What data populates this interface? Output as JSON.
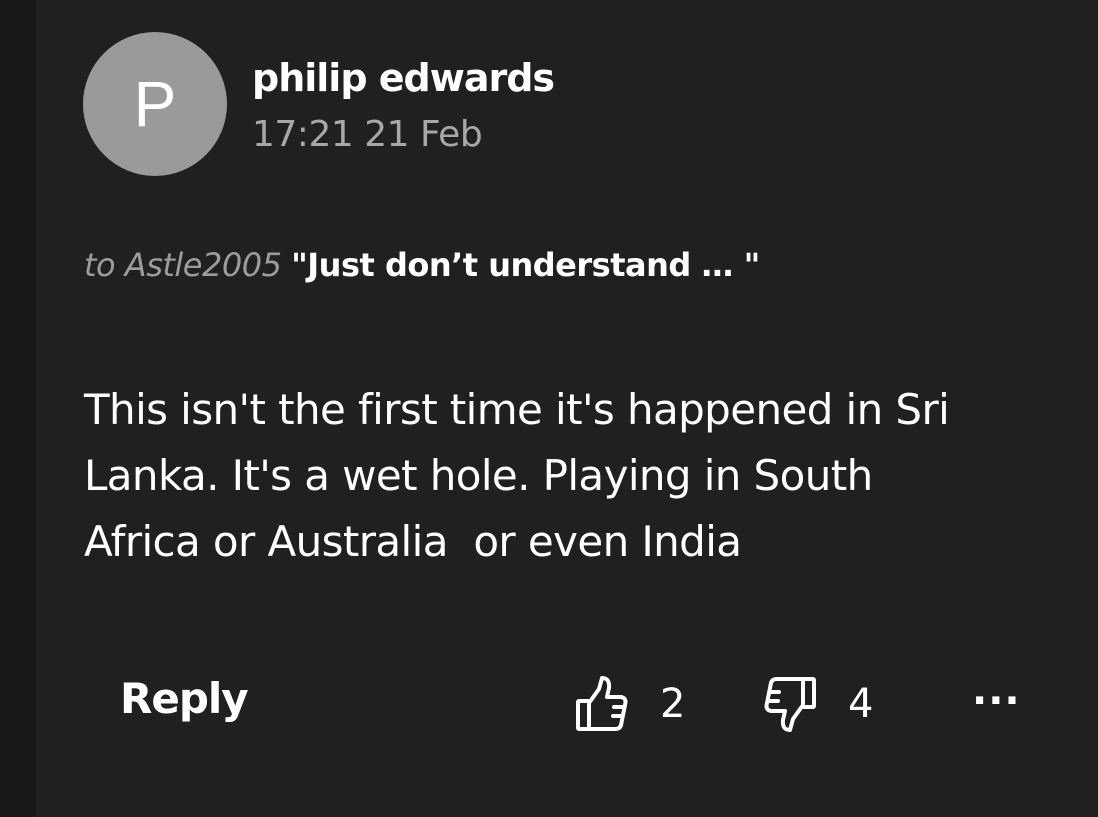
{
  "comment": {
    "avatar_initial": "P",
    "author": "philip edwards",
    "timestamp": "17:21 21 Feb",
    "reply_prefix": "to Astle2005",
    "reply_quote": "\"Just don’t understand … \"",
    "body": "This isn't the first time it's happened in Sri\nLanka. It's a wet hole. Playing in South\nAfrica or Australia  or even India"
  },
  "actions": {
    "reply_label": "Reply",
    "upvote_icon": "thumbs-up-icon",
    "upvote_count": "2",
    "downvote_icon": "thumbs-down-icon",
    "downvote_count": "4",
    "more_label": "...",
    "more_icon": "more-options-icon"
  },
  "colors": {
    "background": "#202020",
    "avatar": "#9a9a9a",
    "muted_text": "#a8a8a8",
    "text": "#ffffff"
  }
}
